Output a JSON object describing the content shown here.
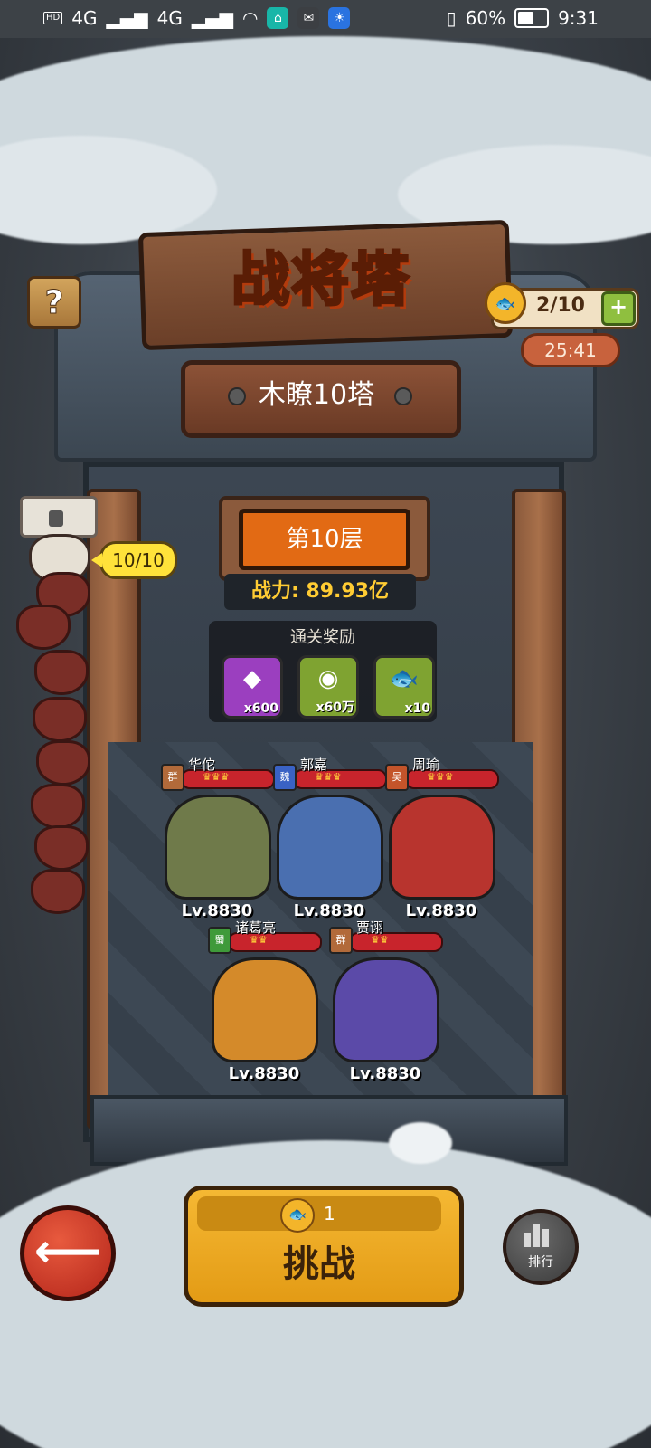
{
  "status_bar": {
    "network_1": "4G",
    "network_2": "4G",
    "battery_percent": "60%",
    "time": "9:31"
  },
  "tower": {
    "title": "战将塔",
    "name": "木瞭10塔",
    "floor_label": "第10层",
    "power_label": "战力: 89.93亿",
    "progress_badge": "10/10"
  },
  "stamina": {
    "count": "2/10",
    "timer": "25:41",
    "plus_label": "+"
  },
  "rewards": {
    "title": "通关奖励",
    "items": [
      {
        "icon": "rune-stone-icon",
        "qty": "x600",
        "color": "#9b3fbf"
      },
      {
        "icon": "gold-coin-icon",
        "qty": "x60万",
        "color": "#7fa331"
      },
      {
        "icon": "fish-stamina-icon",
        "qty": "x10",
        "color": "#7fa331"
      }
    ]
  },
  "heroes": [
    {
      "name": "华佗",
      "faction": "群",
      "faction_color": "#b26a3a",
      "level": "Lv.8830",
      "body_color": "#6f7a4a"
    },
    {
      "name": "郭嘉",
      "faction": "魏",
      "faction_color": "#3a62c4",
      "level": "Lv.8830",
      "body_color": "#4a6fb0"
    },
    {
      "name": "周瑜",
      "faction": "吴",
      "faction_color": "#c4542a",
      "level": "Lv.8830",
      "body_color": "#b8342e"
    },
    {
      "name": "诸葛亮",
      "faction": "蜀",
      "faction_color": "#3f9a3a",
      "level": "Lv.8830",
      "body_color": "#d48a2a"
    },
    {
      "name": "贾诩",
      "faction": "群",
      "faction_color": "#b26a3a",
      "level": "Lv.8830",
      "body_color": "#5b4aa8"
    }
  ],
  "controls": {
    "challenge_label": "挑战",
    "challenge_cost": "1",
    "rank_label": "排行",
    "help_label": "?",
    "back_label": "⟵"
  }
}
